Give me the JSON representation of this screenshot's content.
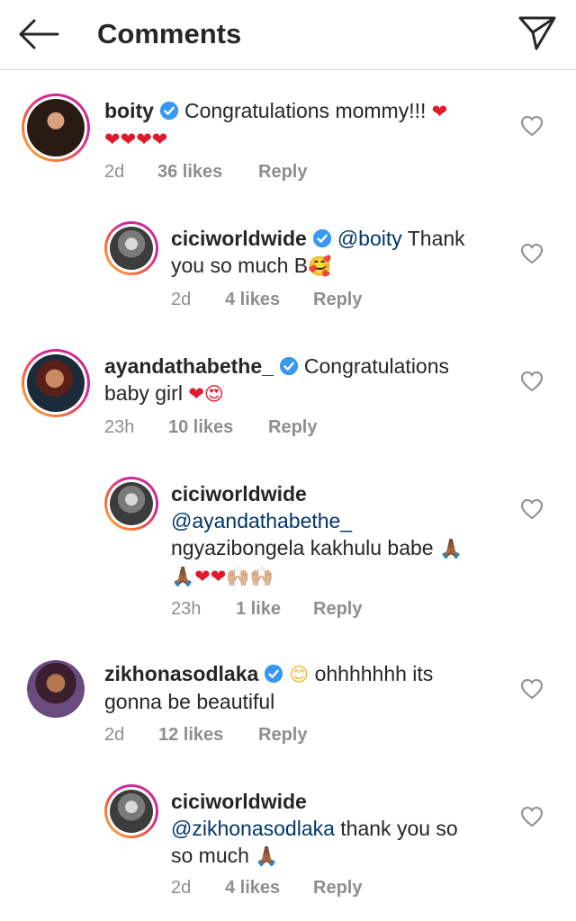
{
  "header": {
    "title": "Comments",
    "back_icon": "back-arrow-icon",
    "send_icon": "direct-send-icon"
  },
  "comments": [
    {
      "username": "boity",
      "verified": true,
      "text": "Congratulations mommy!!!",
      "emoji_line1": "❤",
      "emoji_line2": "❤❤❤❤",
      "time": "2d",
      "likes": "36 likes",
      "reply": "Reply"
    },
    {
      "username": "ciciworldwide",
      "verified": true,
      "mention": "@boity",
      "text_after_mention": "Thank",
      "line2": "you so much B",
      "emoji": "🥰",
      "time": "2d",
      "likes": "4 likes",
      "reply": "Reply"
    },
    {
      "username": "ayandathabethe_",
      "verified": true,
      "text": "Congratulations",
      "line2": "baby girl",
      "emoji": "❤😍",
      "time": "23h",
      "likes": "10 likes",
      "reply": "Reply"
    },
    {
      "username": "ciciworldwide",
      "verified": false,
      "mention": "@ayandathabethe_",
      "line3": "ngyazibongela kakhulu  babe",
      "emoji_line3": "🙏🏾",
      "emoji_line4_hands": "🙏🏾",
      "emoji_line4_hearts": "❤❤",
      "emoji_line4_raised": "🙌🏼🙌🏼",
      "time": "23h",
      "likes": "1 like",
      "reply": "Reply"
    },
    {
      "username": "zikhonasodlaka",
      "verified": true,
      "emoji": "😊",
      "text": "ohhhhhhh its",
      "line2": "gonna be beautiful",
      "time": "2d",
      "likes": "12 likes",
      "reply": "Reply"
    },
    {
      "username": "ciciworldwide",
      "verified": false,
      "mention": "@zikhonasodlaka",
      "text_after_mention": "thank you so",
      "line3": "so much",
      "emoji": "🙏🏾",
      "time": "2d",
      "likes": "4 likes",
      "reply": "Reply"
    }
  ],
  "colors": {
    "text": "#262626",
    "meta": "#8e8e8e",
    "mention": "#00376b",
    "verified": "#3897f0",
    "heart": "#e0192d"
  }
}
